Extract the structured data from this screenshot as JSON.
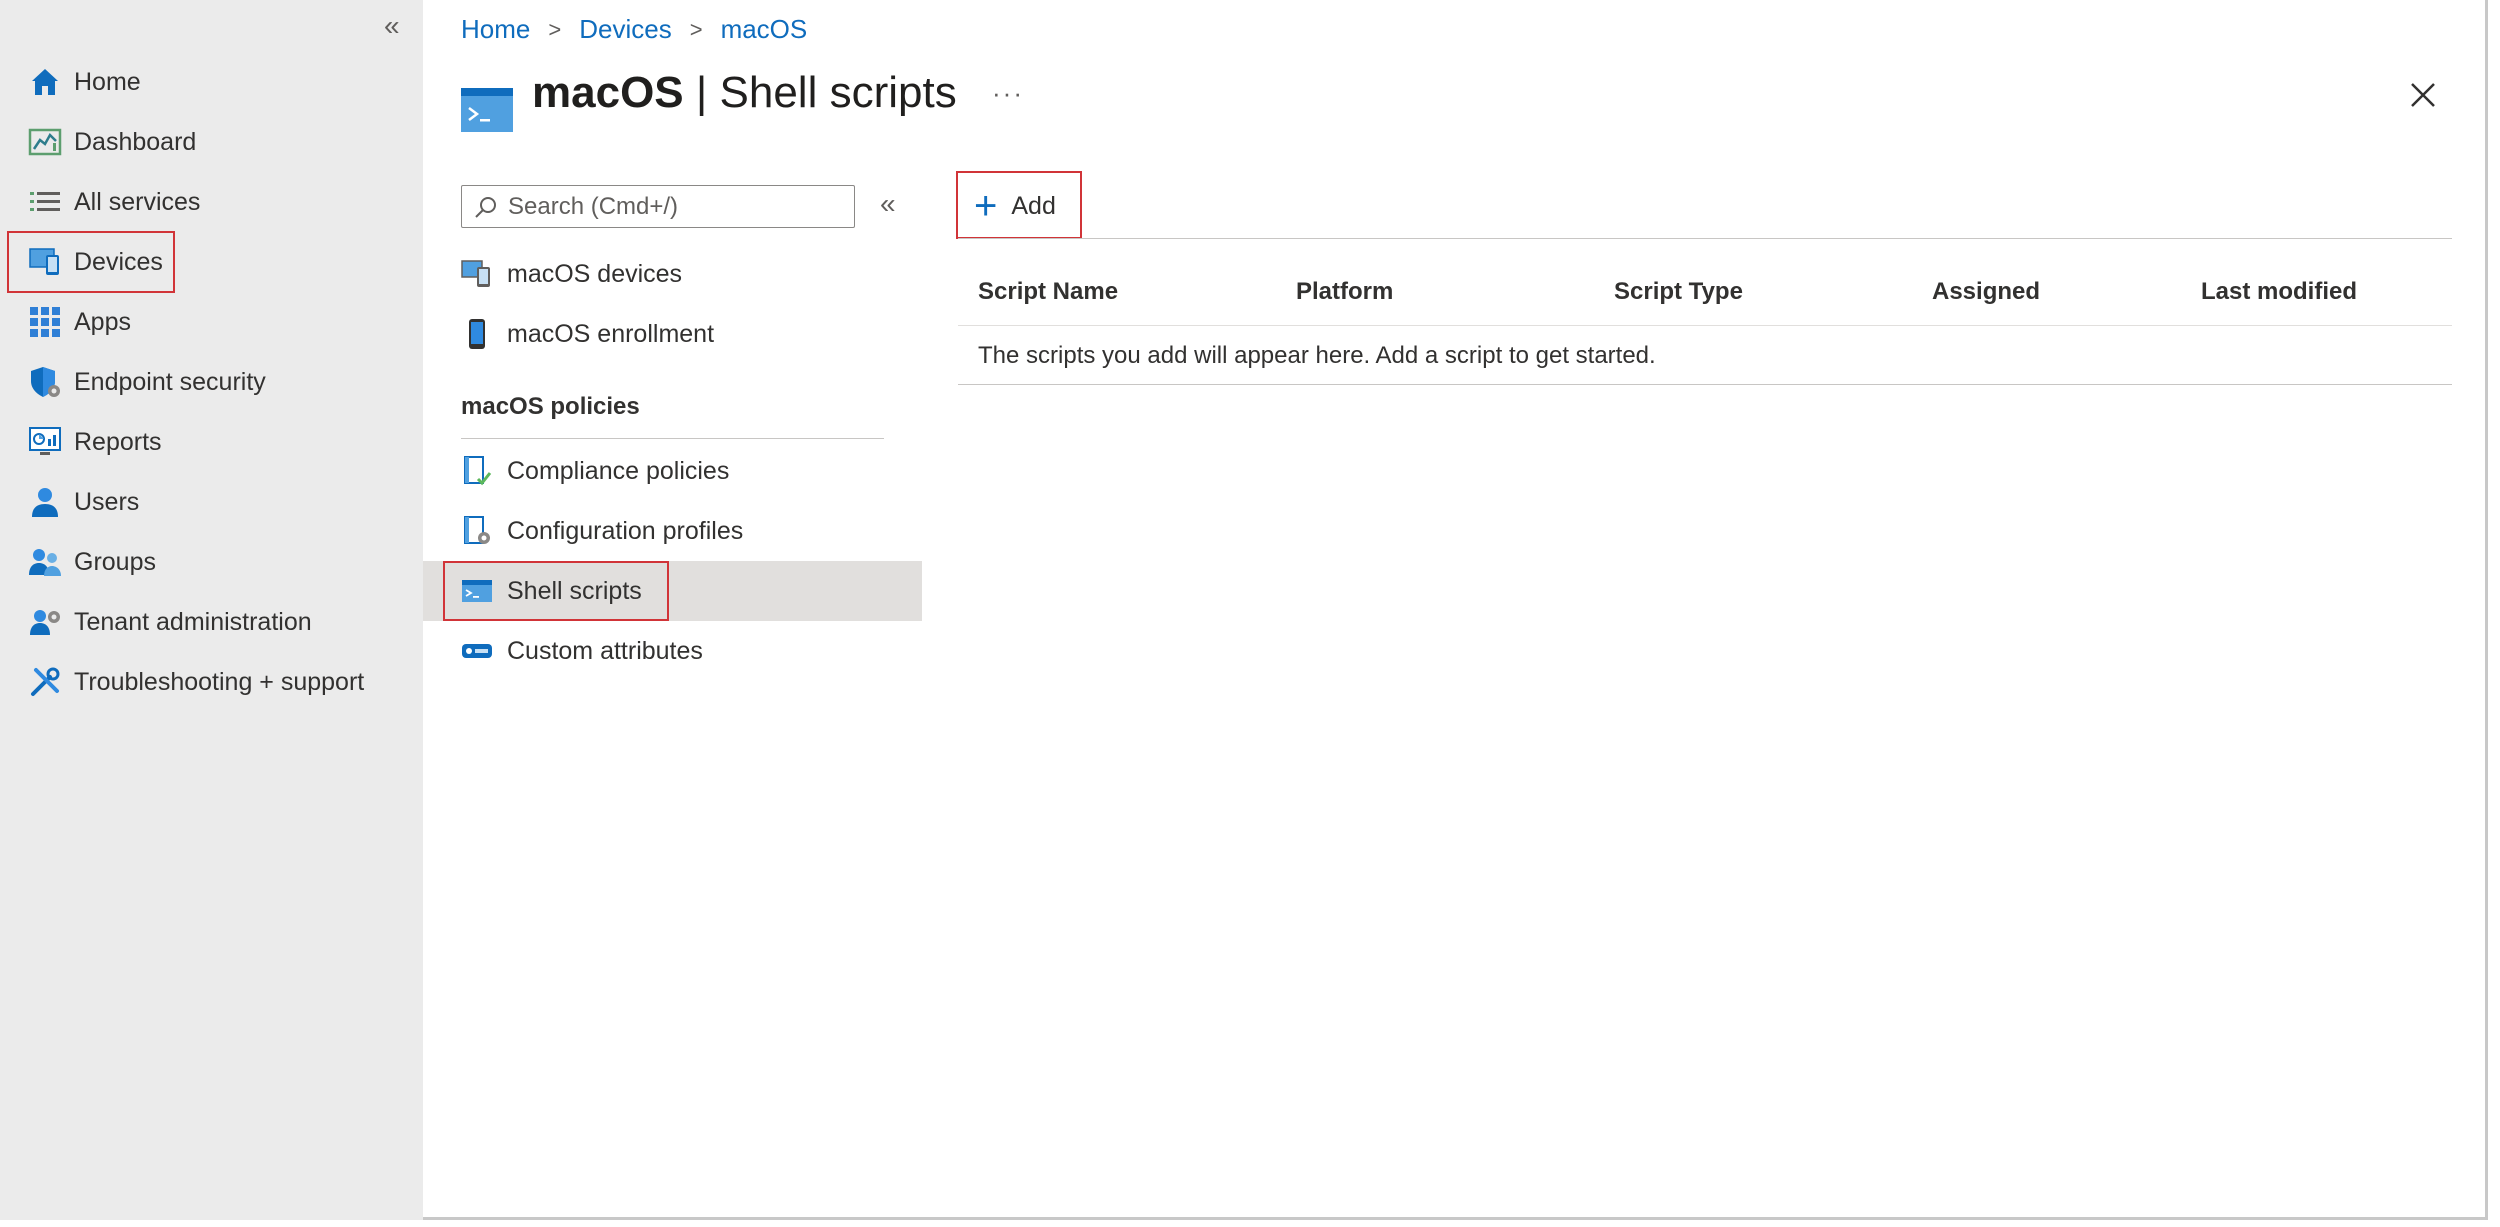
{
  "breadcrumb": [
    {
      "label": "Home"
    },
    {
      "label": "Devices"
    },
    {
      "label": "macOS"
    }
  ],
  "title": {
    "bold": "macOS",
    "rest": " | Shell scripts",
    "more": "···"
  },
  "leftnav": {
    "collapse_glyph": "«",
    "items": [
      {
        "label": "Home",
        "icon": "home-icon"
      },
      {
        "label": "Dashboard",
        "icon": "dashboard-icon"
      },
      {
        "label": "All services",
        "icon": "list-icon"
      },
      {
        "label": "Devices",
        "icon": "devices-icon",
        "highlighted": true
      },
      {
        "label": "Apps",
        "icon": "apps-grid-icon"
      },
      {
        "label": "Endpoint security",
        "icon": "shield-gear-icon"
      },
      {
        "label": "Reports",
        "icon": "reports-icon"
      },
      {
        "label": "Users",
        "icon": "user-icon"
      },
      {
        "label": "Groups",
        "icon": "groups-icon"
      },
      {
        "label": "Tenant administration",
        "icon": "tenant-admin-icon"
      },
      {
        "label": "Troubleshooting + support",
        "icon": "tools-icon"
      }
    ]
  },
  "subnav": {
    "search_placeholder": "Search (Cmd+/)",
    "collapse_glyph": "«",
    "items_top": [
      {
        "label": "macOS devices",
        "icon": "macos-devices-icon"
      },
      {
        "label": "macOS enrollment",
        "icon": "phone-enrollment-icon"
      }
    ],
    "section_title": "macOS policies",
    "items_policies": [
      {
        "label": "Compliance policies",
        "icon": "compliance-icon"
      },
      {
        "label": "Configuration profiles",
        "icon": "config-profile-icon"
      },
      {
        "label": "Shell scripts",
        "icon": "shell-script-icon",
        "selected": true
      },
      {
        "label": "Custom attributes",
        "icon": "custom-attributes-icon"
      }
    ]
  },
  "toolbar": {
    "add_label": "Add"
  },
  "table": {
    "columns": [
      "Script Name",
      "Platform",
      "Script Type",
      "Assigned",
      "Last modified"
    ],
    "empty_message": "The scripts you add will appear here. Add a script to get started."
  },
  "colors": {
    "accent": "#0f6cbd",
    "highlight": "#d13438",
    "nav_bg": "#ebebeb",
    "selected_bg": "#e1dfdd"
  }
}
